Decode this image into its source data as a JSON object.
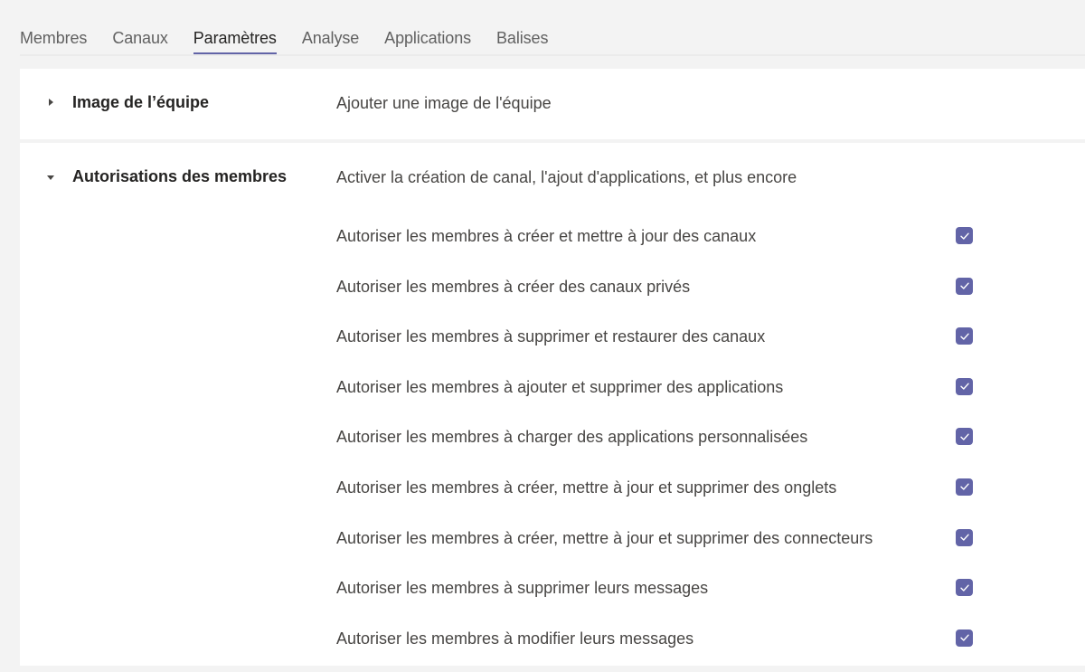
{
  "tabs": [
    {
      "label": "Membres",
      "active": false
    },
    {
      "label": "Canaux",
      "active": false
    },
    {
      "label": "Paramètres",
      "active": true
    },
    {
      "label": "Analyse",
      "active": false
    },
    {
      "label": "Applications",
      "active": false
    },
    {
      "label": "Balises",
      "active": false
    }
  ],
  "colors": {
    "accent": "#6264a7",
    "background": "#f3f3f3",
    "panel": "#ffffff"
  },
  "sections": [
    {
      "title": "Image de l’équipe",
      "description": "Ajouter une image de l'équipe",
      "expanded": false,
      "caret_icon": "caret-right-icon"
    },
    {
      "title": "Autorisations des membres",
      "description": "Activer la création de canal, l'ajout d'applications, et plus encore",
      "expanded": true,
      "caret_icon": "caret-down-icon",
      "options": [
        {
          "label": "Autoriser les membres à créer et mettre à jour des canaux",
          "checked": true
        },
        {
          "label": "Autoriser les membres à créer des canaux privés",
          "checked": true
        },
        {
          "label": "Autoriser les membres à supprimer et restaurer des canaux",
          "checked": true
        },
        {
          "label": "Autoriser les membres à ajouter et supprimer des applications",
          "checked": true
        },
        {
          "label": "Autoriser les membres à charger des applications personnalisées",
          "checked": true
        },
        {
          "label": "Autoriser les membres à créer, mettre à jour et supprimer des onglets",
          "checked": true
        },
        {
          "label": "Autoriser les membres à créer, mettre à jour et supprimer des connecteurs",
          "checked": true
        },
        {
          "label": "Autoriser les membres à supprimer leurs messages",
          "checked": true
        },
        {
          "label": "Autoriser les membres à modifier leurs messages",
          "checked": true
        }
      ]
    }
  ]
}
